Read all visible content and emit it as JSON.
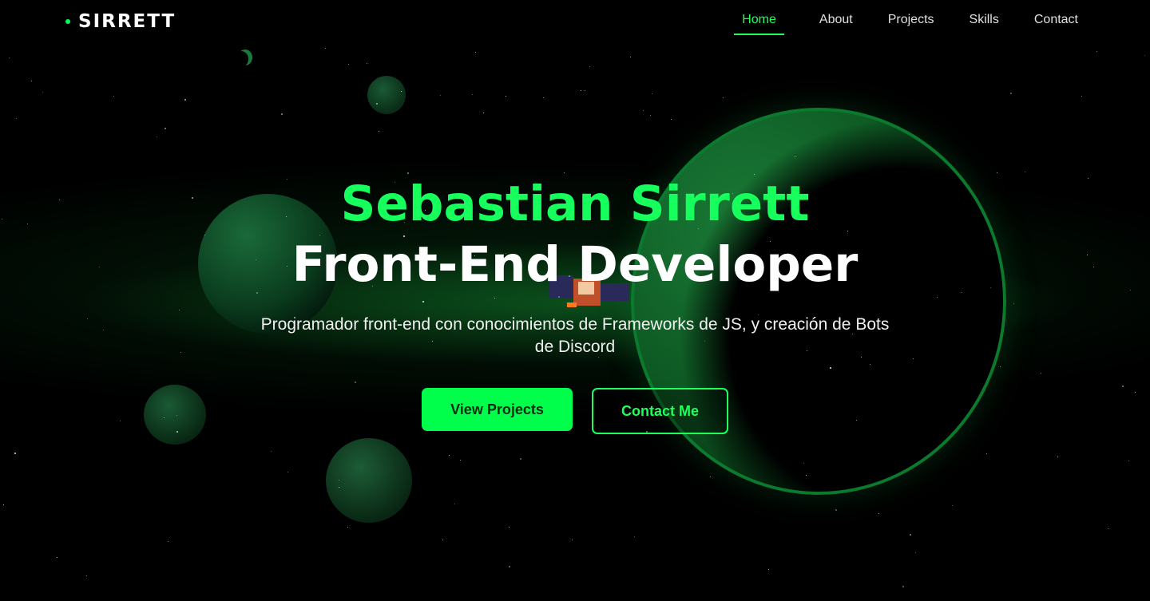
{
  "nav": {
    "logo": "SIRRETT",
    "links": [
      {
        "label": "Home",
        "active": true
      },
      {
        "label": "About",
        "active": false
      },
      {
        "label": "Projects",
        "active": false
      },
      {
        "label": "Skills",
        "active": false
      },
      {
        "label": "Contact",
        "active": false
      }
    ]
  },
  "hero": {
    "name": "Sebastian Sirrett",
    "role": "Front-End Developer",
    "description": "Programador front-end con conocimientos de Frameworks de JS, y creación de Bots de Discord",
    "primary_button": "View Projects",
    "secondary_button": "Contact Me"
  },
  "theme": {
    "accent": "#00ff4a",
    "background": "#000000"
  }
}
